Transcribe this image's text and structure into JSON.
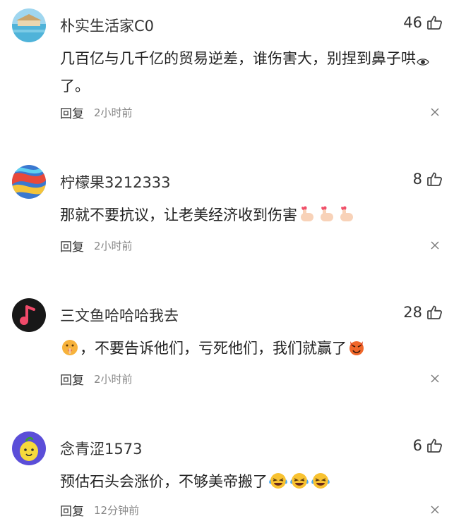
{
  "colors": {
    "text": "#222222",
    "username": "#333333",
    "meta": "#888888",
    "icon": "#444444"
  },
  "comments": [
    {
      "username": "朴实生活家C0",
      "likes": "46",
      "text_before": "几百亿与几千亿的贸易逆差，谁伤害大，别捏到鼻子哄",
      "text_after": "了。",
      "reply": "回复",
      "time": "2小时前",
      "emojis": [
        "eye-emoji"
      ]
    },
    {
      "username": "柠檬果3212333",
      "likes": "8",
      "text_before": "那就不要抗议，让老美经济收到伤害",
      "text_after": "",
      "reply": "回复",
      "time": "2小时前",
      "emojis": [
        "finger-heart-emoji",
        "finger-heart-emoji",
        "finger-heart-emoji"
      ]
    },
    {
      "username": "三文鱼哈哈哈我去",
      "likes": "28",
      "text_before": "，不要告诉他们，亏死他们，我们就赢了",
      "text_after": "",
      "reply": "回复",
      "time": "2小时前",
      "emojis": [
        "shushing-face-emoji",
        "devil-emoji"
      ]
    },
    {
      "username": "念青涩1573",
      "likes": "6",
      "text_before": "预估石头会涨价，不够美帝搬了",
      "text_after": "",
      "reply": "回复",
      "time": "12分钟前",
      "emojis": [
        "laughing-tears-emoji",
        "laughing-tears-emoji",
        "laughing-tears-emoji"
      ]
    }
  ]
}
